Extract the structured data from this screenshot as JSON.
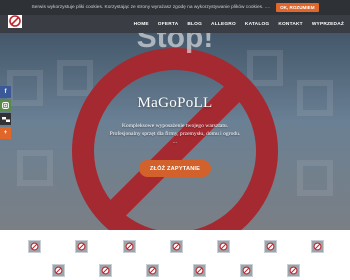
{
  "cookie": {
    "text": "Serwis wykorzystuje pliki cookies. Korzystając ze strony wyrażasz zgodę na wykorzystywanie plików cookies. ....",
    "button": "OK, ROZUMIEM"
  },
  "nav": {
    "items": [
      "HOME",
      "OFERTA",
      "BLOG",
      "ALLEGRO",
      "KATALOG",
      "KONTAKT",
      "WYPRZEDAŻ"
    ]
  },
  "hero": {
    "background_text": "Stop!",
    "title": "MaGoPoLL",
    "line1": "Kompleksowe wyposażenie twojego warsztatu.",
    "line2": "Profesjonalny sprzęt dla firmy, przemysłu, domu i ogrodu.",
    "line3": "...",
    "cta": "ZŁÓŻ ZAPYTANIE"
  },
  "social": {
    "icons": [
      "facebook-icon",
      "instagram-icon",
      "delicious-icon",
      "plus-icon"
    ]
  },
  "colors": {
    "accent": "#e0662a",
    "header": "#3a3e44",
    "cookie_bar": "#2e3136",
    "sign_red": "#c0262b"
  }
}
